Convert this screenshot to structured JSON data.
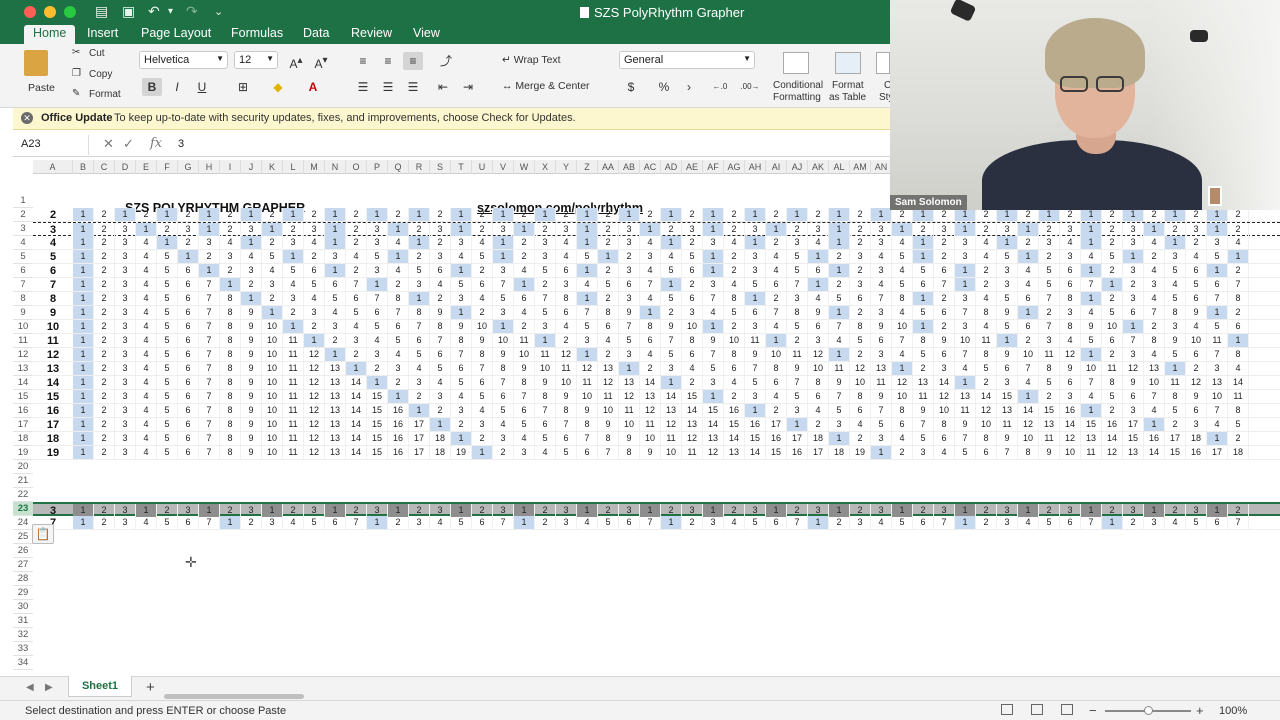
{
  "window": {
    "title": "SZS PolyRhythm Grapher"
  },
  "tabs": [
    "Home",
    "Insert",
    "Page Layout",
    "Formulas",
    "Data",
    "Review",
    "View"
  ],
  "ribbon": {
    "paste": "Paste",
    "cut": "Cut",
    "copy": "Copy",
    "format": "Format",
    "font_name": "Helvetica",
    "font_size": "12",
    "bold": "B",
    "italic": "I",
    "underline": "U",
    "wrap_text": "Wrap Text",
    "merge_center": "Merge & Center",
    "number_format": "General",
    "currency": "$",
    "percent": "%",
    "comma": "›",
    "inc_decimal": "←.0",
    "dec_decimal": ".00→",
    "cond_formatting_1": "Conditional",
    "cond_formatting_2": "Formatting",
    "format_table_1": "Format",
    "format_table_2": "as Table",
    "cell_styles_1": "C",
    "cell_styles_2": "Sty"
  },
  "update_bar": {
    "title": "Office Update",
    "message": "To keep up-to-date with security updates, fixes, and improvements, choose Check for Updates."
  },
  "formula_bar": {
    "name_box": "A23",
    "fx": "fx",
    "value": "3"
  },
  "columns": [
    "A",
    "B",
    "C",
    "D",
    "E",
    "F",
    "G",
    "H",
    "I",
    "J",
    "K",
    "L",
    "M",
    "N",
    "O",
    "P",
    "Q",
    "R",
    "S",
    "T",
    "U",
    "V",
    "W",
    "X",
    "Y",
    "Z",
    "AA",
    "AB",
    "AC",
    "AD",
    "AE",
    "AF",
    "AG",
    "AH",
    "AI",
    "AJ",
    "AK",
    "AL",
    "AM",
    "AN"
  ],
  "sheet": {
    "title": "SZS POLYRHYTHM GRAPHER",
    "link": "szsolomon.com/polyrhythm",
    "cycle_columns": 56,
    "grid_rows": [
      2,
      3,
      4,
      5,
      6,
      7,
      8,
      9,
      10,
      11,
      12,
      13,
      14,
      15,
      16,
      17,
      18,
      19
    ],
    "selected_row": {
      "row": 23,
      "value": 3
    },
    "pasted_row": {
      "row": 24,
      "value": 7
    },
    "row_numbers": [
      1,
      2,
      3,
      4,
      5,
      6,
      7,
      8,
      9,
      10,
      11,
      12,
      13,
      14,
      15,
      16,
      17,
      18,
      19,
      20,
      21,
      22,
      23,
      24,
      25,
      26,
      27,
      28,
      29,
      30,
      31,
      32,
      33,
      34
    ]
  },
  "sheet_tab": "Sheet1",
  "add_sheet": "+",
  "status": {
    "text": "Select destination and press ENTER or choose Paste",
    "zoom": "100%"
  },
  "webcam": {
    "name": "Sam Solomon"
  },
  "colors": {
    "ribbon_green": "#1e7145",
    "beat_highlight": "#c6d9ef",
    "selection_gray": "#b8b8b8"
  }
}
